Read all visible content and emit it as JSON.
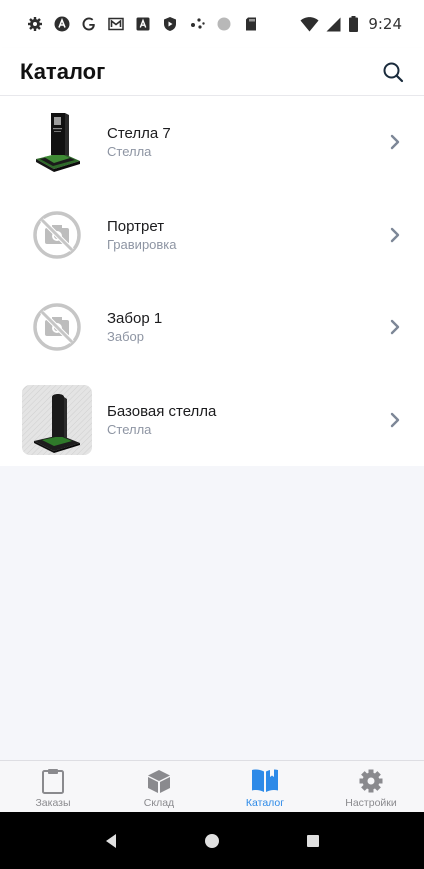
{
  "status_bar": {
    "time": "9:24",
    "icons": [
      "settings-gear-icon",
      "a-circle-icon",
      "google-g-icon",
      "gmail-icon",
      "a-square-icon",
      "shield-play-icon",
      "dots-icon",
      "circle-icon",
      "sd-card-icon"
    ],
    "right_icons": [
      "wifi-icon",
      "signal-icon",
      "battery-icon"
    ]
  },
  "header": {
    "title": "Каталог",
    "search_icon": "search-icon"
  },
  "catalog": {
    "items": [
      {
        "title": "Стелла 7",
        "subtitle": "Стелла",
        "thumb": "stele-photo"
      },
      {
        "title": "Портрет",
        "subtitle": "Гравировка",
        "thumb": "no-photo-icon"
      },
      {
        "title": "Забор 1",
        "subtitle": "Забор",
        "thumb": "no-photo-icon"
      },
      {
        "title": "Базовая стелла",
        "subtitle": "Стелла",
        "thumb": "stele-photo"
      }
    ]
  },
  "tabbar": {
    "tabs": [
      {
        "label": "Заказы",
        "icon": "clipboard-icon"
      },
      {
        "label": "Склад",
        "icon": "box-icon"
      },
      {
        "label": "Каталог",
        "icon": "book-icon",
        "active": true
      },
      {
        "label": "Настройки",
        "icon": "gear-icon"
      }
    ]
  },
  "colors": {
    "accent": "#2d8ae8",
    "inactive": "#8a8a8e",
    "subtitle": "#8e95a3"
  }
}
